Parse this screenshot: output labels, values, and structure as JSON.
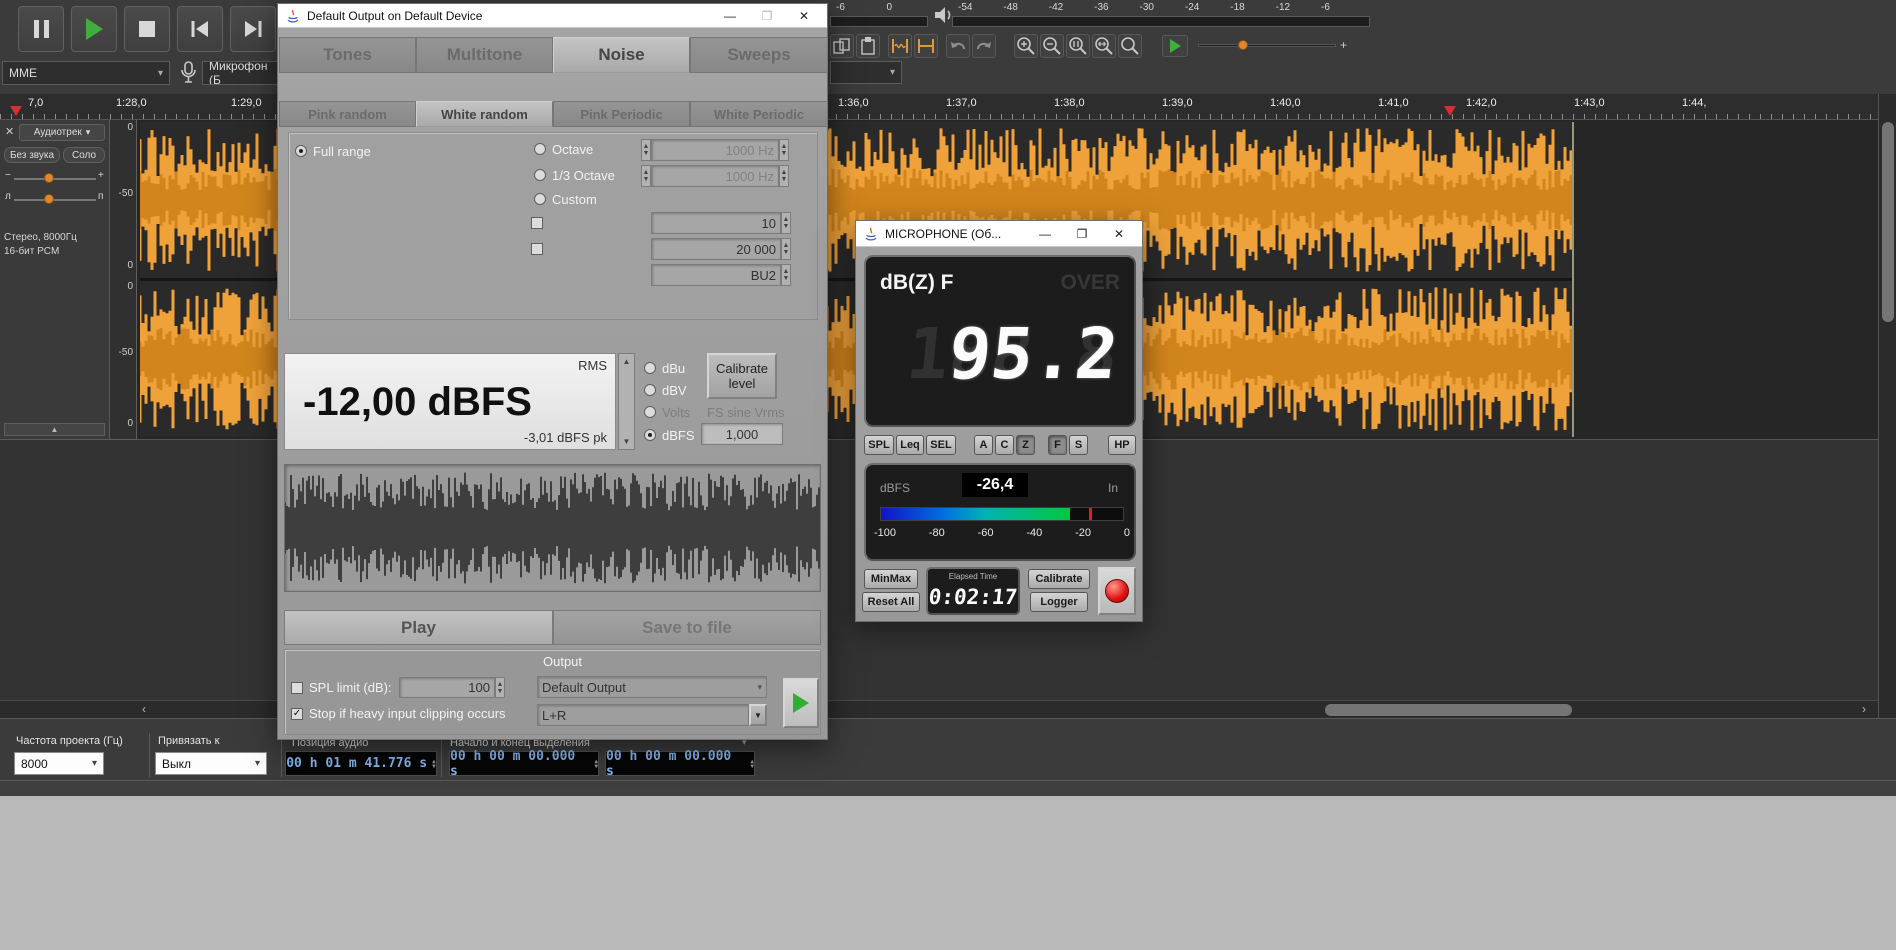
{
  "icons": {
    "close": "✕",
    "minimize": "—",
    "maximize": "❐",
    "caret_down": "▾",
    "up": "▲",
    "down": "▼",
    "check": "✓",
    "scroll_left": "‹",
    "scroll_right": "›",
    "collapse_up": "▲"
  },
  "audacity": {
    "device_toolbar": {
      "host": "MME",
      "input": "Микрофон (Б"
    },
    "meters": {
      "left_scale": [
        "-6",
        "0"
      ],
      "scale": [
        "-54",
        "-48",
        "-42",
        "-36",
        "-30",
        "-24",
        "-18",
        "-12",
        "-6"
      ]
    },
    "speed_plus": "+",
    "timeline": {
      "labels": [
        "7,0",
        "1:28,0",
        "1:29,0",
        "1:36,0",
        "1:37,0",
        "1:38,0",
        "1:39,0",
        "1:40,0",
        "1:41,0",
        "1:42,0",
        "1:43,0",
        "1:44,"
      ]
    },
    "track": {
      "name": "Аудиотрек",
      "mute": "Без звука",
      "solo": "Соло",
      "gain_min": "−",
      "gain_max": "+",
      "pan_left": "л",
      "pan_right": "п",
      "info_line1": "Стерео, 8000Гц",
      "info_line2": "16-бит PCM",
      "scale": [
        "0",
        "-50",
        "0"
      ]
    },
    "selection_bar": {
      "rate_label": "Частота проекта (Гц)",
      "snap_label": "Привязать к",
      "position_label": "Позиция аудио",
      "selection_label": "Начало и конец выделения",
      "rate_value": "8000",
      "snap_value": "Выкл",
      "position_value": "00 h 01 m 41.776 s",
      "selection_start": "00 h 00 m 00.000 s",
      "selection_end": "00 h 00 m 00.000 s"
    }
  },
  "generator": {
    "title": "Default Output on Default Device",
    "tabs": [
      "Tones",
      "Multitone",
      "Noise",
      "Sweeps"
    ],
    "subtabs": [
      "Pink random",
      "White random",
      "Pink Periodic",
      "White Periodic"
    ],
    "range": {
      "full": "Full range",
      "octave": "Octave",
      "third": "1/3 Octave",
      "custom": "Custom",
      "octave_freq": "1000 Hz",
      "third_freq": "1000 Hz",
      "field_low": "10",
      "field_high": "20 000",
      "field_unit": "BU2"
    },
    "level": {
      "rms": "RMS",
      "value": "-12,00 dBFS",
      "peak": "-3,01 dBFS pk",
      "units": [
        "dBu",
        "dBV",
        "Volts",
        "dBFS"
      ],
      "calibrate": "Calibrate level",
      "fs_sine": "FS sine Vrms",
      "fs_value": "1,000"
    },
    "actions": {
      "play": "Play",
      "save": "Save to file"
    },
    "output": {
      "label": "Output",
      "spl_label": "SPL limit (dB):",
      "spl_value": "100",
      "clip_label": "Stop if heavy input clipping occurs",
      "device": "Default Output",
      "routing": "L+R"
    }
  },
  "meter": {
    "title": "MICROPHONE (Об...",
    "mode": "dB(Z) F",
    "over": "OVER",
    "ghost": "188.8",
    "reading": "95.2",
    "buttons": [
      "SPL",
      "Leq",
      "SEL",
      "A",
      "C",
      "Z",
      "F",
      "S",
      "HP"
    ],
    "dbfs_label": "dBFS",
    "dbfs_value": "-26,4",
    "input_label": "In",
    "scale": [
      "-100",
      "-80",
      "-60",
      "-40",
      "-20",
      "0"
    ],
    "minmax": "MinMax",
    "reset": "Reset All",
    "elapsed_label": "Elapsed Time",
    "elapsed_value": "0:02:17",
    "calibrate": "Calibrate",
    "logger": "Logger"
  }
}
